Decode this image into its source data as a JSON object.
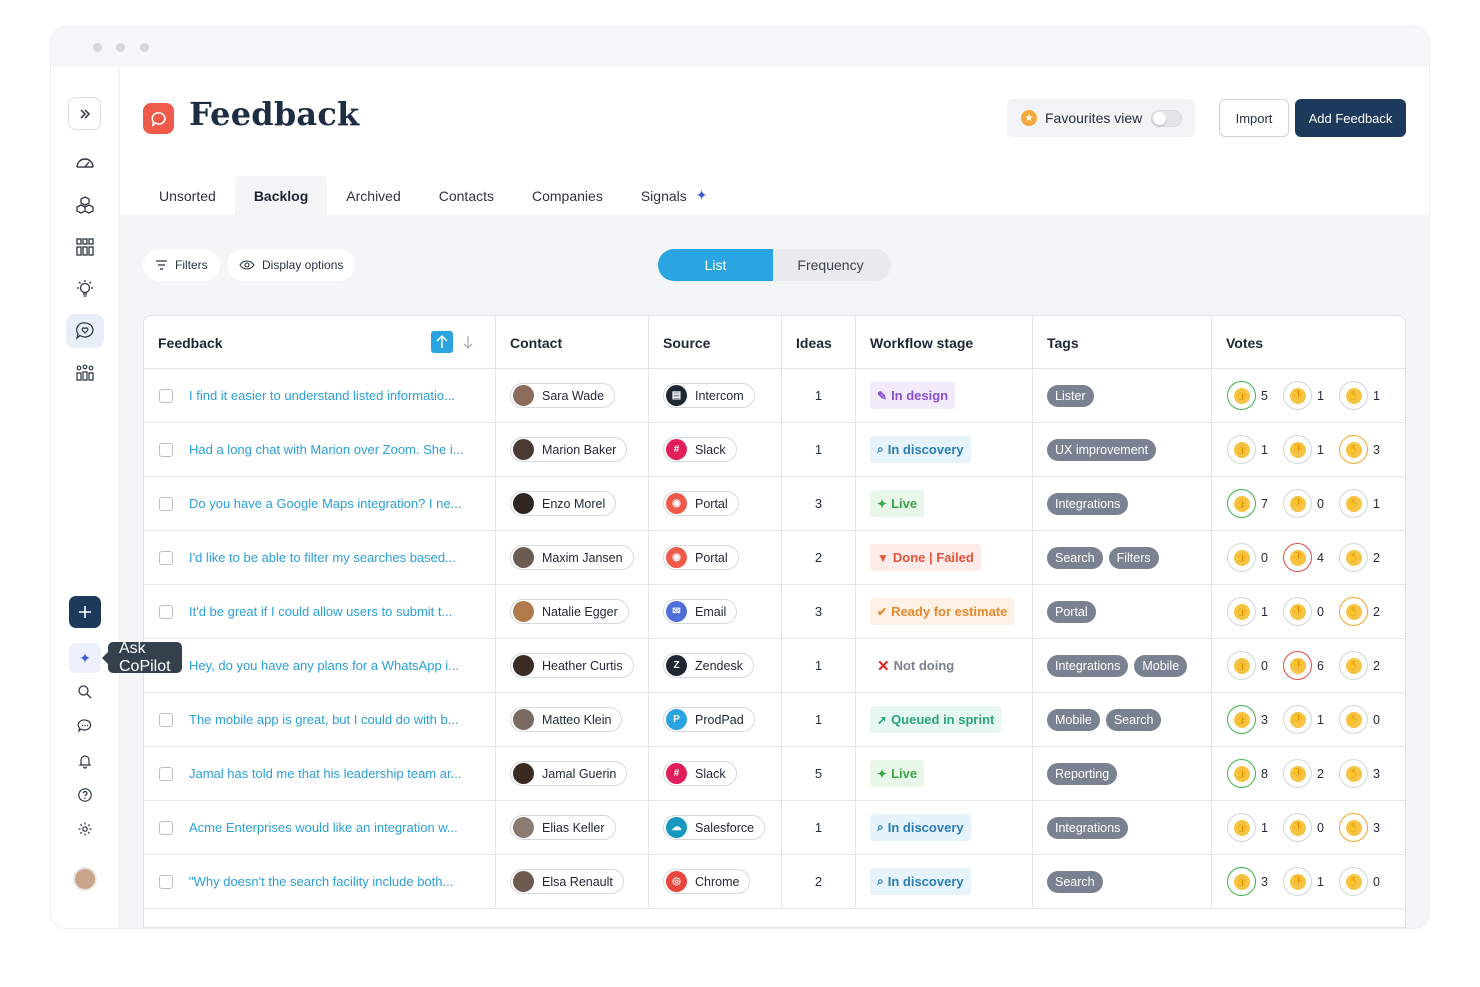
{
  "app": {
    "page_title": "Feedback",
    "favourites_label": "Favourites view",
    "import_label": "Import",
    "add_label": "Add Feedback",
    "tooltip": "Ask CoPilot"
  },
  "tabs": [
    {
      "label": "Unsorted"
    },
    {
      "label": "Backlog"
    },
    {
      "label": "Archived"
    },
    {
      "label": "Contacts"
    },
    {
      "label": "Companies"
    },
    {
      "label": "Signals"
    }
  ],
  "toolbar": {
    "filters_label": "Filters",
    "display_label": "Display options",
    "view_list": "List",
    "view_frequency": "Frequency"
  },
  "columns": {
    "feedback": "Feedback",
    "contact": "Contact",
    "source": "Source",
    "ideas": "Ideas",
    "stage": "Workflow stage",
    "tags": "Tags",
    "votes": "Votes"
  },
  "colors": {
    "accent": "#2aa4e0",
    "primary": "#1d3a5c",
    "logo": "#ef5a4b"
  },
  "rows": [
    {
      "text": "I find it easier to understand listed informatio...",
      "contact": "Sara Wade",
      "avatar": "#8c6b5a",
      "source": "Intercom",
      "src_color": "#1f2733",
      "src_glyph": "▤",
      "ideas": "1",
      "stage": "In design",
      "stage_icon": "✎",
      "stage_fg": "#8a4fd0",
      "stage_bg": "#f2ebfb",
      "tags": [
        "Lister"
      ],
      "votes": [
        {
          "n": "5",
          "c": "green"
        },
        {
          "n": "1",
          "c": ""
        },
        {
          "n": "1",
          "c": ""
        }
      ]
    },
    {
      "text": "Had a long chat with Marion over Zoom. She i...",
      "contact": "Marion Baker",
      "avatar": "#4a3a34",
      "source": "Slack",
      "src_color": "#e01e5a",
      "src_glyph": "#",
      "ideas": "1",
      "stage": "In discovery",
      "stage_icon": "⌕",
      "stage_fg": "#2a7fb8",
      "stage_bg": "#e6f3fb",
      "tags": [
        "UX improvement"
      ],
      "votes": [
        {
          "n": "1",
          "c": ""
        },
        {
          "n": "1",
          "c": ""
        },
        {
          "n": "3",
          "c": "orange"
        }
      ]
    },
    {
      "text": "Do you have a Google Maps integration? I ne...",
      "contact": "Enzo Morel",
      "avatar": "#2f2622",
      "source": "Portal",
      "src_color": "#ef5a4b",
      "src_glyph": "◉",
      "ideas": "3",
      "stage": "Live",
      "stage_icon": "✦",
      "stage_fg": "#3aa54a",
      "stage_bg": "#e9f7ea",
      "tags": [
        "Integrations"
      ],
      "votes": [
        {
          "n": "7",
          "c": "green"
        },
        {
          "n": "0",
          "c": ""
        },
        {
          "n": "1",
          "c": ""
        }
      ]
    },
    {
      "text": "I'd like to be able to filter my searches based...",
      "contact": "Maxim Jansen",
      "avatar": "#6b5b52",
      "source": "Portal",
      "src_color": "#ef5a4b",
      "src_glyph": "◉",
      "ideas": "2",
      "stage": "Done | Failed",
      "stage_icon": "▼",
      "stage_fg": "#e2543b",
      "stage_bg": "#fdecea",
      "tags": [
        "Search",
        "Filters"
      ],
      "votes": [
        {
          "n": "0",
          "c": ""
        },
        {
          "n": "4",
          "c": "red"
        },
        {
          "n": "2",
          "c": ""
        }
      ]
    },
    {
      "text": "It'd be great if I could allow users to submit t...",
      "contact": "Natalie Egger",
      "avatar": "#b07a4a",
      "source": "Email",
      "src_color": "#4f6fd8",
      "src_glyph": "✉",
      "ideas": "3",
      "stage": "Ready for estimate",
      "stage_icon": "✔",
      "stage_fg": "#e5892b",
      "stage_bg": "#fdf2e5",
      "tags": [
        "Portal"
      ],
      "votes": [
        {
          "n": "1",
          "c": ""
        },
        {
          "n": "0",
          "c": ""
        },
        {
          "n": "2",
          "c": "orange"
        }
      ]
    },
    {
      "text": "Hey, do you have any plans for a WhatsApp i...",
      "contact": "Heather Curtis",
      "avatar": "#3b2c26",
      "source": "Zendesk",
      "src_color": "#1f2733",
      "src_glyph": "Z",
      "ideas": "1",
      "stage": "Not doing",
      "stage_icon": "✕",
      "stage_fg": "#7a8190",
      "stage_bg": "#ffffff",
      "tags": [
        "Integrations",
        "Mobile"
      ],
      "votes": [
        {
          "n": "0",
          "c": ""
        },
        {
          "n": "6",
          "c": "red"
        },
        {
          "n": "2",
          "c": ""
        }
      ]
    },
    {
      "text": "The mobile app is great, but I could do with b...",
      "contact": "Matteo Klein",
      "avatar": "#7a6a62",
      "source": "ProdPad",
      "src_color": "#2aa4e0",
      "src_glyph": "P",
      "ideas": "1",
      "stage": "Queued in sprint",
      "stage_icon": "➚",
      "stage_fg": "#2aa57a",
      "stage_bg": "#e6f6f0",
      "tags": [
        "Mobile",
        "Search"
      ],
      "votes": [
        {
          "n": "3",
          "c": "green"
        },
        {
          "n": "1",
          "c": ""
        },
        {
          "n": "0",
          "c": ""
        }
      ]
    },
    {
      "text": "Jamal has told me that his leadership team ar...",
      "contact": "Jamal Guerin",
      "avatar": "#3a2a22",
      "source": "Slack",
      "src_color": "#e01e5a",
      "src_glyph": "#",
      "ideas": "5",
      "stage": "Live",
      "stage_icon": "✦",
      "stage_fg": "#3aa54a",
      "stage_bg": "#e9f7ea",
      "tags": [
        "Reporting"
      ],
      "votes": [
        {
          "n": "8",
          "c": "green"
        },
        {
          "n": "2",
          "c": ""
        },
        {
          "n": "3",
          "c": ""
        }
      ]
    },
    {
      "text": "Acme Enterprises would like an integration w...",
      "contact": "Elias Keller",
      "avatar": "#8a7a72",
      "source": "Salesforce",
      "src_color": "#1798c1",
      "src_glyph": "☁",
      "ideas": "1",
      "stage": "In discovery",
      "stage_icon": "⌕",
      "stage_fg": "#2a7fb8",
      "stage_bg": "#e6f3fb",
      "tags": [
        "Integrations"
      ],
      "votes": [
        {
          "n": "1",
          "c": ""
        },
        {
          "n": "0",
          "c": ""
        },
        {
          "n": "3",
          "c": "orange"
        }
      ]
    },
    {
      "text": "\"Why doesn't the search facility include both...",
      "contact": "Elsa Renault",
      "avatar": "#6e5a50",
      "source": "Chrome",
      "src_color": "#e8453c",
      "src_glyph": "◎",
      "ideas": "2",
      "stage": "In discovery",
      "stage_icon": "⌕",
      "stage_fg": "#2a7fb8",
      "stage_bg": "#e6f3fb",
      "tags": [
        "Search"
      ],
      "votes": [
        {
          "n": "3",
          "c": "green"
        },
        {
          "n": "1",
          "c": ""
        },
        {
          "n": "0",
          "c": ""
        }
      ]
    }
  ]
}
